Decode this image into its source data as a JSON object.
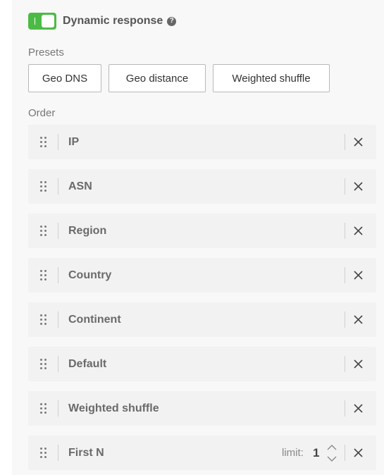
{
  "dynamic_response": {
    "label": "Dynamic response",
    "enabled": true,
    "help_glyph": "?",
    "accent_color": "#4cbb45"
  },
  "presets": {
    "label": "Presets",
    "buttons": [
      "Geo DNS",
      "Geo distance",
      "Weighted shuffle"
    ]
  },
  "order": {
    "label": "Order",
    "items": [
      {
        "label": "IP"
      },
      {
        "label": "ASN"
      },
      {
        "label": "Region"
      },
      {
        "label": "Country"
      },
      {
        "label": "Continent"
      },
      {
        "label": "Default"
      },
      {
        "label": "Weighted shuffle"
      },
      {
        "label": "First N",
        "limit_label": "limit:",
        "limit_value": "1"
      }
    ]
  }
}
